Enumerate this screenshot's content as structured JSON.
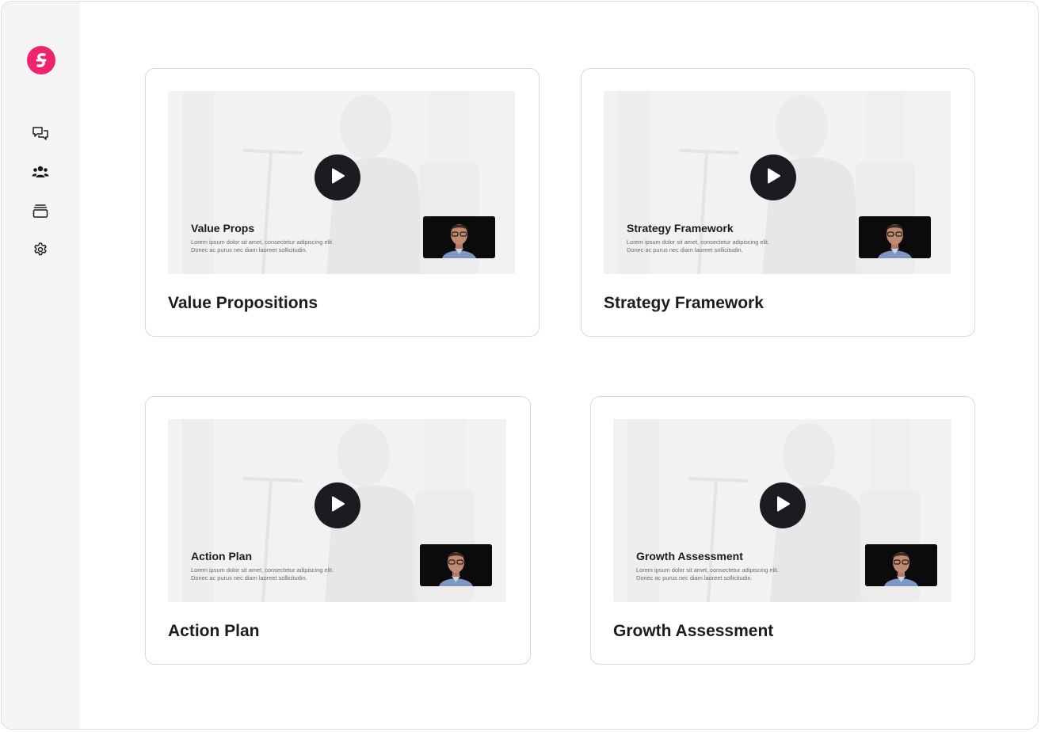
{
  "sidebar": {
    "logo_icon": "brand-logo-icon",
    "brand_color": "#f0246c",
    "nav": [
      {
        "icon": "chat-icon",
        "name": "nav-item-chats"
      },
      {
        "icon": "users-icon",
        "name": "nav-item-people"
      },
      {
        "icon": "stack-icon",
        "name": "nav-item-library"
      },
      {
        "icon": "gear-icon",
        "name": "nav-item-settings"
      }
    ]
  },
  "cards": [
    {
      "thumb_title": "Value Props",
      "thumb_desc": "Lorem ipsum dolor sit amet, consectetur adipiscing elit. Donec ac purus nec diam laoreet sollicitudin.",
      "title": "Value Propositions"
    },
    {
      "thumb_title": "Strategy Framework",
      "thumb_desc": "Lorem ipsum dolor sit amet, consectetur adipiscing elit. Donec ac purus nec diam laoreet sollicitudin.",
      "title": "Strategy Framework"
    },
    {
      "thumb_title": "Action Plan",
      "thumb_desc": "Lorem ipsum dolor sit amet, consectetur adipiscing elit. Donec ac purus nec diam laoreet sollicitudin.",
      "title": "Action Plan"
    },
    {
      "thumb_title": "Growth Assessment",
      "thumb_desc": "Lorem ipsum dolor sit amet, consectetur adipiscing elit. Donec ac purus nec diam laoreet sollicitudin.",
      "title": "Growth Assessment"
    }
  ],
  "colors": {
    "text": "#1b1c22",
    "play_button": "#1b1c22",
    "card_border": "#dadade",
    "sidebar_bg": "#f6f5f6"
  }
}
